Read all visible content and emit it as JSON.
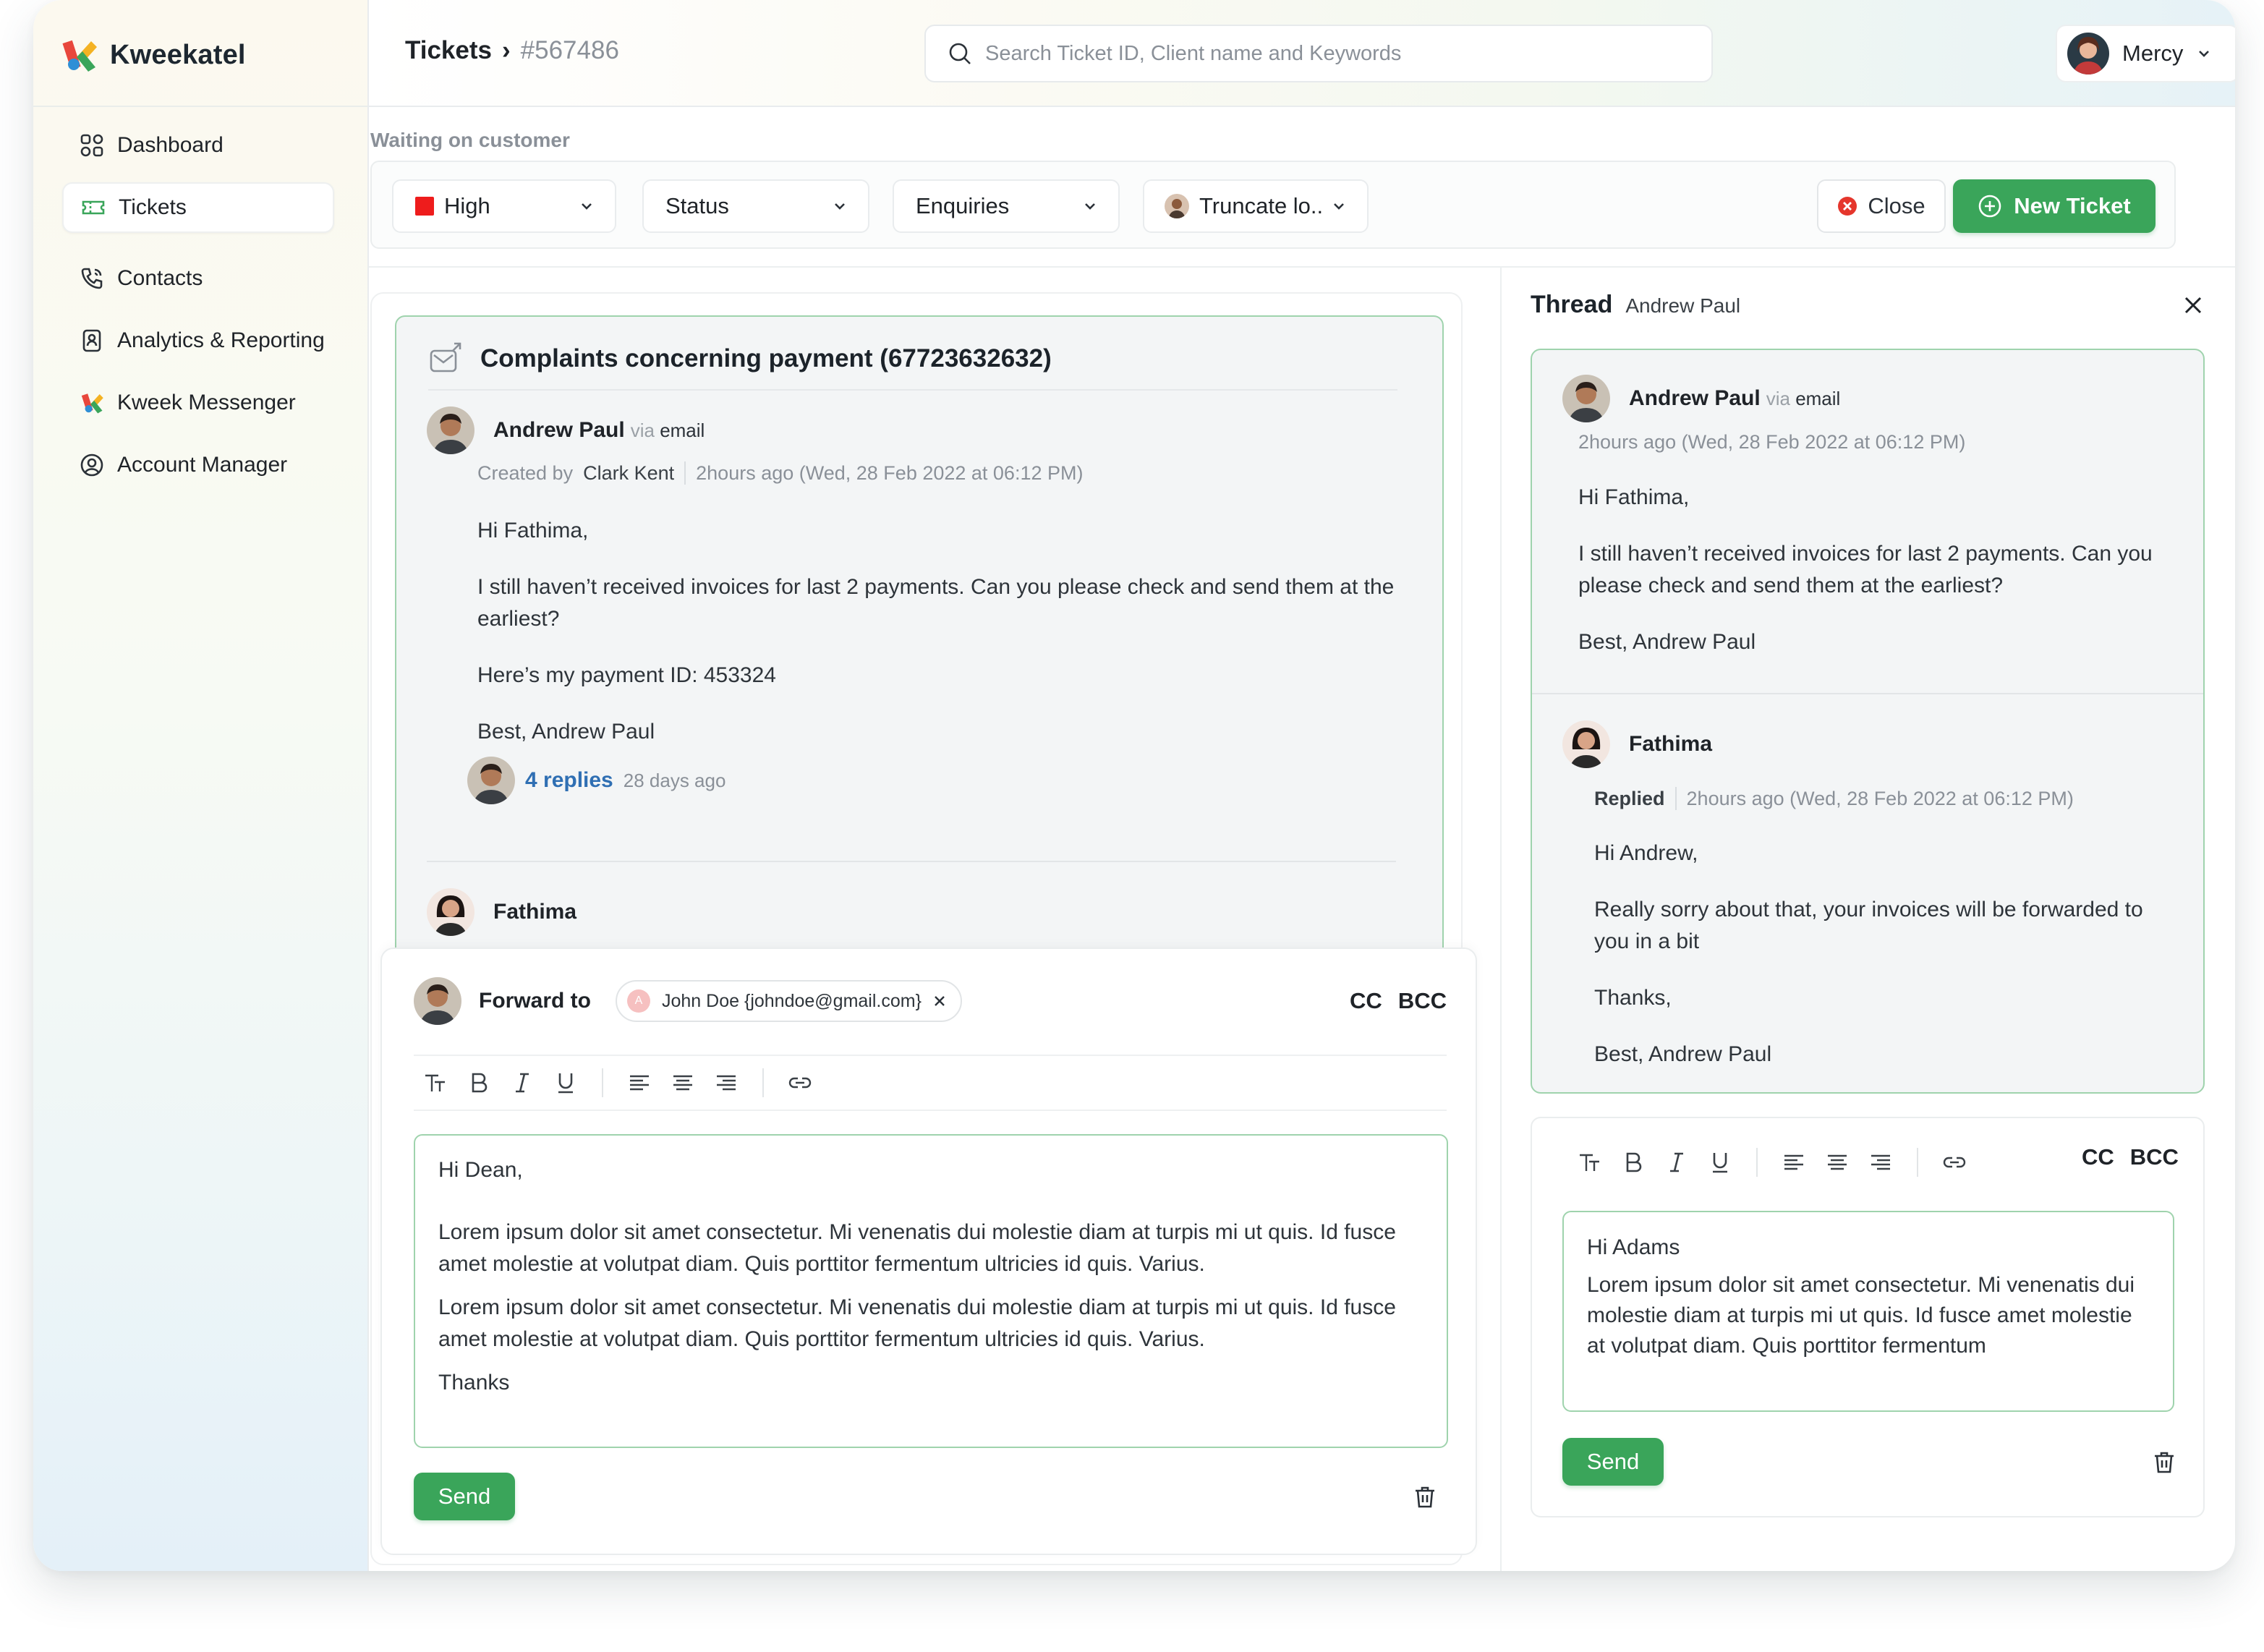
{
  "brand": {
    "name": "Kweekatel"
  },
  "sidebar": {
    "items": [
      {
        "label": "Dashboard",
        "icon": "dashboard-icon"
      },
      {
        "label": "Tickets",
        "icon": "ticket-icon"
      },
      {
        "label": "Contacts",
        "icon": "phone-icon"
      },
      {
        "label": "Analytics & Reporting",
        "icon": "report-icon"
      },
      {
        "label": "Kweek Messenger",
        "icon": "messenger-logo-icon"
      },
      {
        "label": "Account Manager",
        "icon": "user-circle-icon"
      }
    ],
    "active_index": 1
  },
  "header": {
    "breadcrumb_root": "Tickets",
    "breadcrumb_separator": "›",
    "breadcrumb_current": "#567486",
    "search_placeholder": "Search Ticket ID, Client name and Keywords",
    "user_name": "Mercy"
  },
  "filters": {
    "status_text": "Waiting on customer",
    "priority": "High",
    "status": "Status",
    "category": "Enquiries",
    "assignee": "Truncate lo..",
    "close_label": "Close",
    "new_ticket_label": "New Ticket"
  },
  "ticket": {
    "title": "Complaints concerning payment (67723632632)",
    "message": {
      "author": "Andrew Paul",
      "via_prefix": "via",
      "via_channel": "email",
      "created_by_label": "Created by",
      "created_by": "Clark Kent",
      "time": "2hours ago (Wed, 28 Feb 2022 at 06:12 PM)",
      "greeting": "Hi Fathima,",
      "line1": "I still haven’t received invoices for last 2 payments. Can you please check and send them at the earliest?",
      "line2": "Here’s my payment ID: 453324",
      "signoff": "Best, Andrew Paul",
      "replies_link": "4 replies",
      "replies_ago": "28 days ago"
    },
    "next_author": "Fathima"
  },
  "composer": {
    "forward_label": "Forward to",
    "recipient_initial": "A",
    "recipient": "John Doe {johndoe@gmail.com}",
    "cc": "CC",
    "bcc": "BCC",
    "body_greeting": "Hi Dean,",
    "body_p1": "Lorem ipsum dolor sit amet consectetur. Mi venenatis dui molestie diam at turpis mi ut quis. Id fusce amet molestie at volutpat diam. Quis porttitor fermentum ultricies id quis. Varius.",
    "body_p2": "Lorem ipsum dolor sit amet consectetur. Mi venenatis dui molestie diam at turpis mi ut quis. Id fusce amet molestie at volutpat diam. Quis porttitor fermentum ultricies id quis. Varius.",
    "body_thanks": "Thanks",
    "send_label": "Send"
  },
  "thread": {
    "title": "Thread",
    "subtitle": "Andrew Paul",
    "msg1": {
      "author": "Andrew Paul",
      "via_prefix": "via",
      "via_channel": "email",
      "time": "2hours ago (Wed, 28 Feb 2022 at 06:12 PM)",
      "greeting": "Hi Fathima,",
      "line1": "I still haven’t received invoices for last 2 payments. Can you please check and send them at the earliest?",
      "signoff": "Best, Andrew Paul"
    },
    "msg2": {
      "author": "Fathima",
      "replied_label": "Replied",
      "time": "2hours ago (Wed, 28 Feb 2022 at 06:12 PM)",
      "greeting": "Hi Andrew,",
      "line1": "Really sorry about that, your invoices will be forwarded to you in a bit",
      "thanks": "Thanks,",
      "signoff": "Best, Andrew Paul"
    },
    "reply": {
      "cc": "CC",
      "bcc": "BCC",
      "greeting": "Hi Adams",
      "body": "Lorem ipsum dolor sit amet consectetur. Mi venenatis dui molestie diam at turpis mi ut quis. Id fusce amet molestie at volutpat diam. Quis porttitor fermentum",
      "send_label": "Send"
    }
  },
  "colors": {
    "accent_green": "#3aa55a",
    "border_green": "#9fd3ad",
    "priority_red": "#ee1c1c",
    "link_blue": "#2f6fb3"
  }
}
